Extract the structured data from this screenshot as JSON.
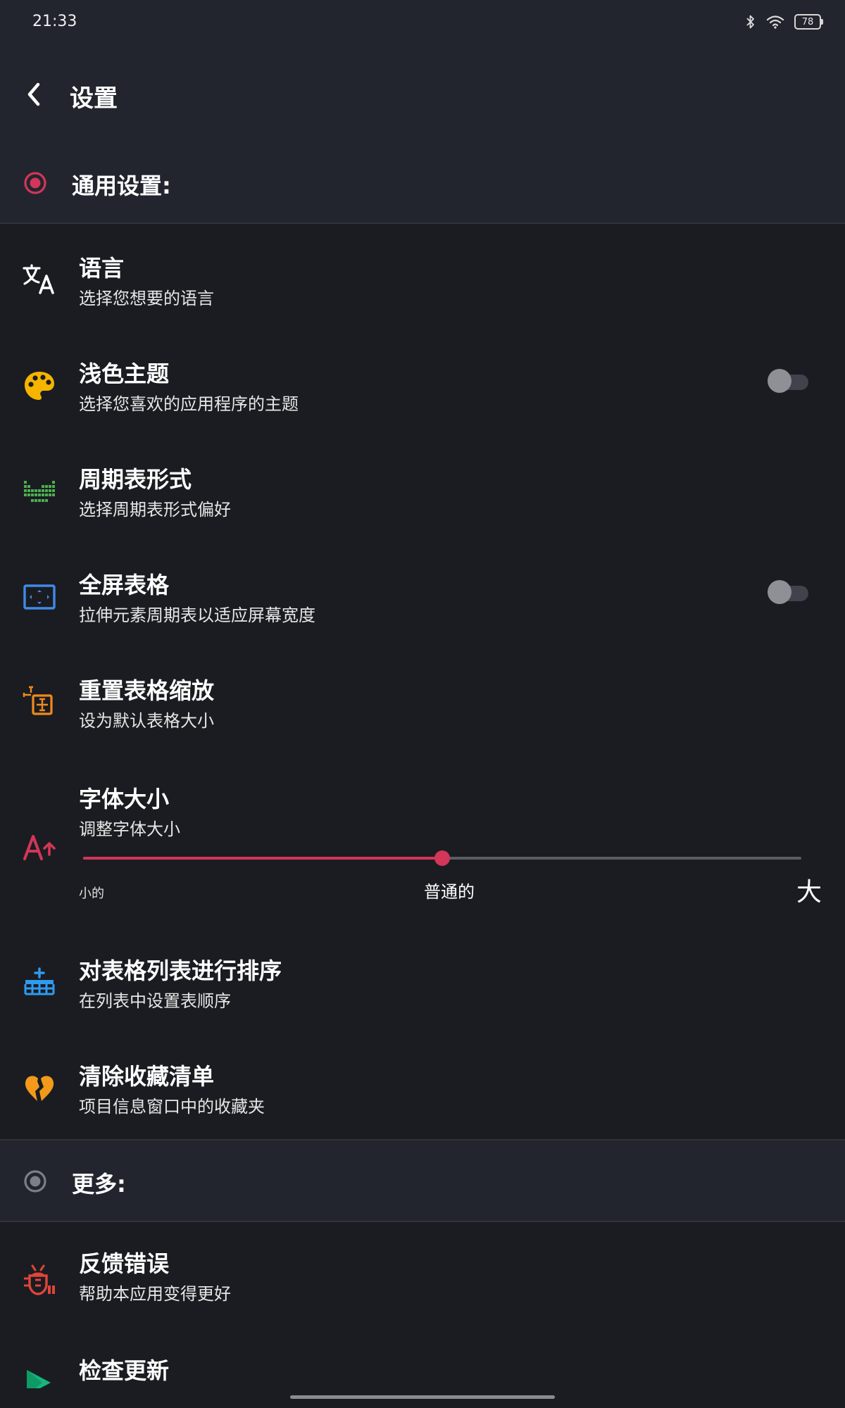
{
  "status_bar": {
    "time": "21:33",
    "battery": "78"
  },
  "header": {
    "title": "设置"
  },
  "sections": {
    "general": {
      "label": "通用设置:"
    },
    "more": {
      "label": "更多:"
    }
  },
  "items": {
    "language": {
      "title": "语言",
      "subtitle": "选择您想要的语言"
    },
    "light_theme": {
      "title": "浅色主题",
      "subtitle": "选择您喜欢的应用程序的主题",
      "enabled": false
    },
    "table_format": {
      "title": "周期表形式",
      "subtitle": "选择周期表形式偏好"
    },
    "fullscreen_table": {
      "title": "全屏表格",
      "subtitle": "拉伸元素周期表以适应屏幕宽度",
      "enabled": false
    },
    "reset_zoom": {
      "title": "重置表格缩放",
      "subtitle": "设为默认表格大小"
    },
    "font_size": {
      "title": "字体大小",
      "subtitle": "调整字体大小",
      "slider_value": 0.5,
      "scale_small": "小的",
      "scale_normal": "普通的",
      "scale_large": "大"
    },
    "sort_tables": {
      "title": "对表格列表进行排序",
      "subtitle": "在列表中设置表顺序"
    },
    "clear_favorites": {
      "title": "清除收藏清单",
      "subtitle": "项目信息窗口中的收藏夹"
    },
    "report_bug": {
      "title": "反馈错误",
      "subtitle": "帮助本应用变得更好"
    },
    "check_update": {
      "title": "检查更新"
    }
  },
  "icons": {
    "language": "translate-icon",
    "light_theme": "palette-icon",
    "table_format": "periodic-table-icon",
    "fullscreen_table": "fullscreen-icon",
    "reset_zoom": "reset-zoom-icon",
    "font_size": "font-size-icon",
    "sort_tables": "sort-table-icon",
    "clear_favorites": "broken-heart-icon",
    "report_bug": "bug-icon",
    "check_update": "play-store-icon"
  },
  "colors": {
    "accent": "#d23658",
    "background": "#1b1c21",
    "header_background": "#22252e",
    "palette_icon": "#f5b400",
    "table_icon": "#4caf50",
    "fullscreen_icon": "#3f8ae8",
    "reset_icon": "#ef8a1c",
    "sort_icon": "#2e9bf0",
    "heart_icon": "#f39a1a",
    "bug_icon": "#e0443a",
    "play_icon": "#17b57a"
  }
}
